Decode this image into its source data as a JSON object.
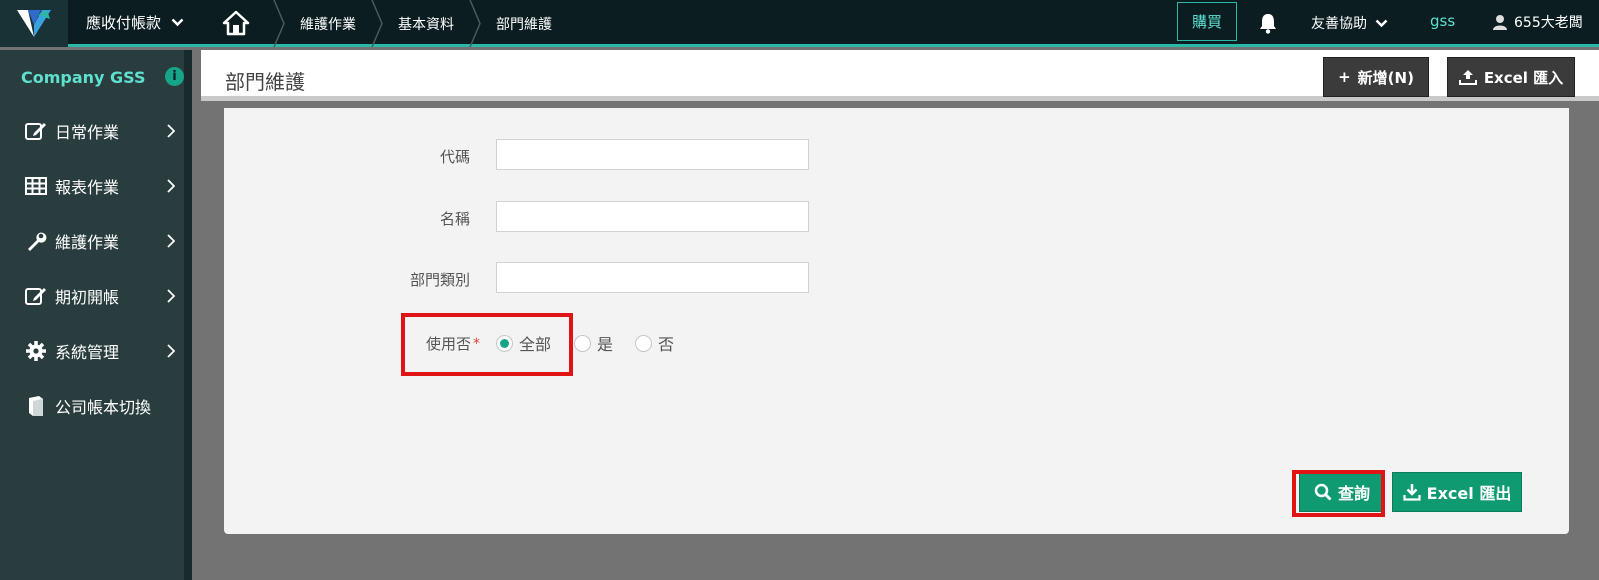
{
  "topbar": {
    "app_menu_label": "應收付帳款",
    "breadcrumbs": [
      "維護作業",
      "基本資料",
      "部門維護"
    ],
    "buy_label": "購買",
    "help_label": "友善協助",
    "gss_label": "gss",
    "user_label": "655大老闆"
  },
  "sidebar": {
    "company": "Company GSS",
    "info_glyph": "i",
    "items": [
      {
        "label": "日常作業",
        "icon": "edit-icon"
      },
      {
        "label": "報表作業",
        "icon": "table-icon"
      },
      {
        "label": "維護作業",
        "icon": "wrench-icon"
      },
      {
        "label": "期初開帳",
        "icon": "edit-icon"
      },
      {
        "label": "系統管理",
        "icon": "gear-icon"
      },
      {
        "label": "公司帳本切換",
        "icon": "book-icon"
      }
    ]
  },
  "header": {
    "title": "部門維護",
    "add_label": "新增(N)",
    "add_glyph": "+",
    "import_label": "Excel 匯入"
  },
  "form": {
    "code_label": "代碼",
    "code_value": "",
    "name_label": "名稱",
    "name_value": "",
    "type_label": "部門類別",
    "type_value": "",
    "active_label": "使用否",
    "required_mark": "*",
    "active_options": [
      "全部",
      "是",
      "否"
    ],
    "active_selected": "全部"
  },
  "actions": {
    "query_label": "查詢",
    "export_label": "Excel 匯出"
  },
  "colors": {
    "accent": "#2cb8a8",
    "primary_button": "#0f9a72",
    "highlight": "#e01414",
    "sidebar_bg": "#2a3d3e",
    "topbar_bg": "#0b1d20"
  }
}
